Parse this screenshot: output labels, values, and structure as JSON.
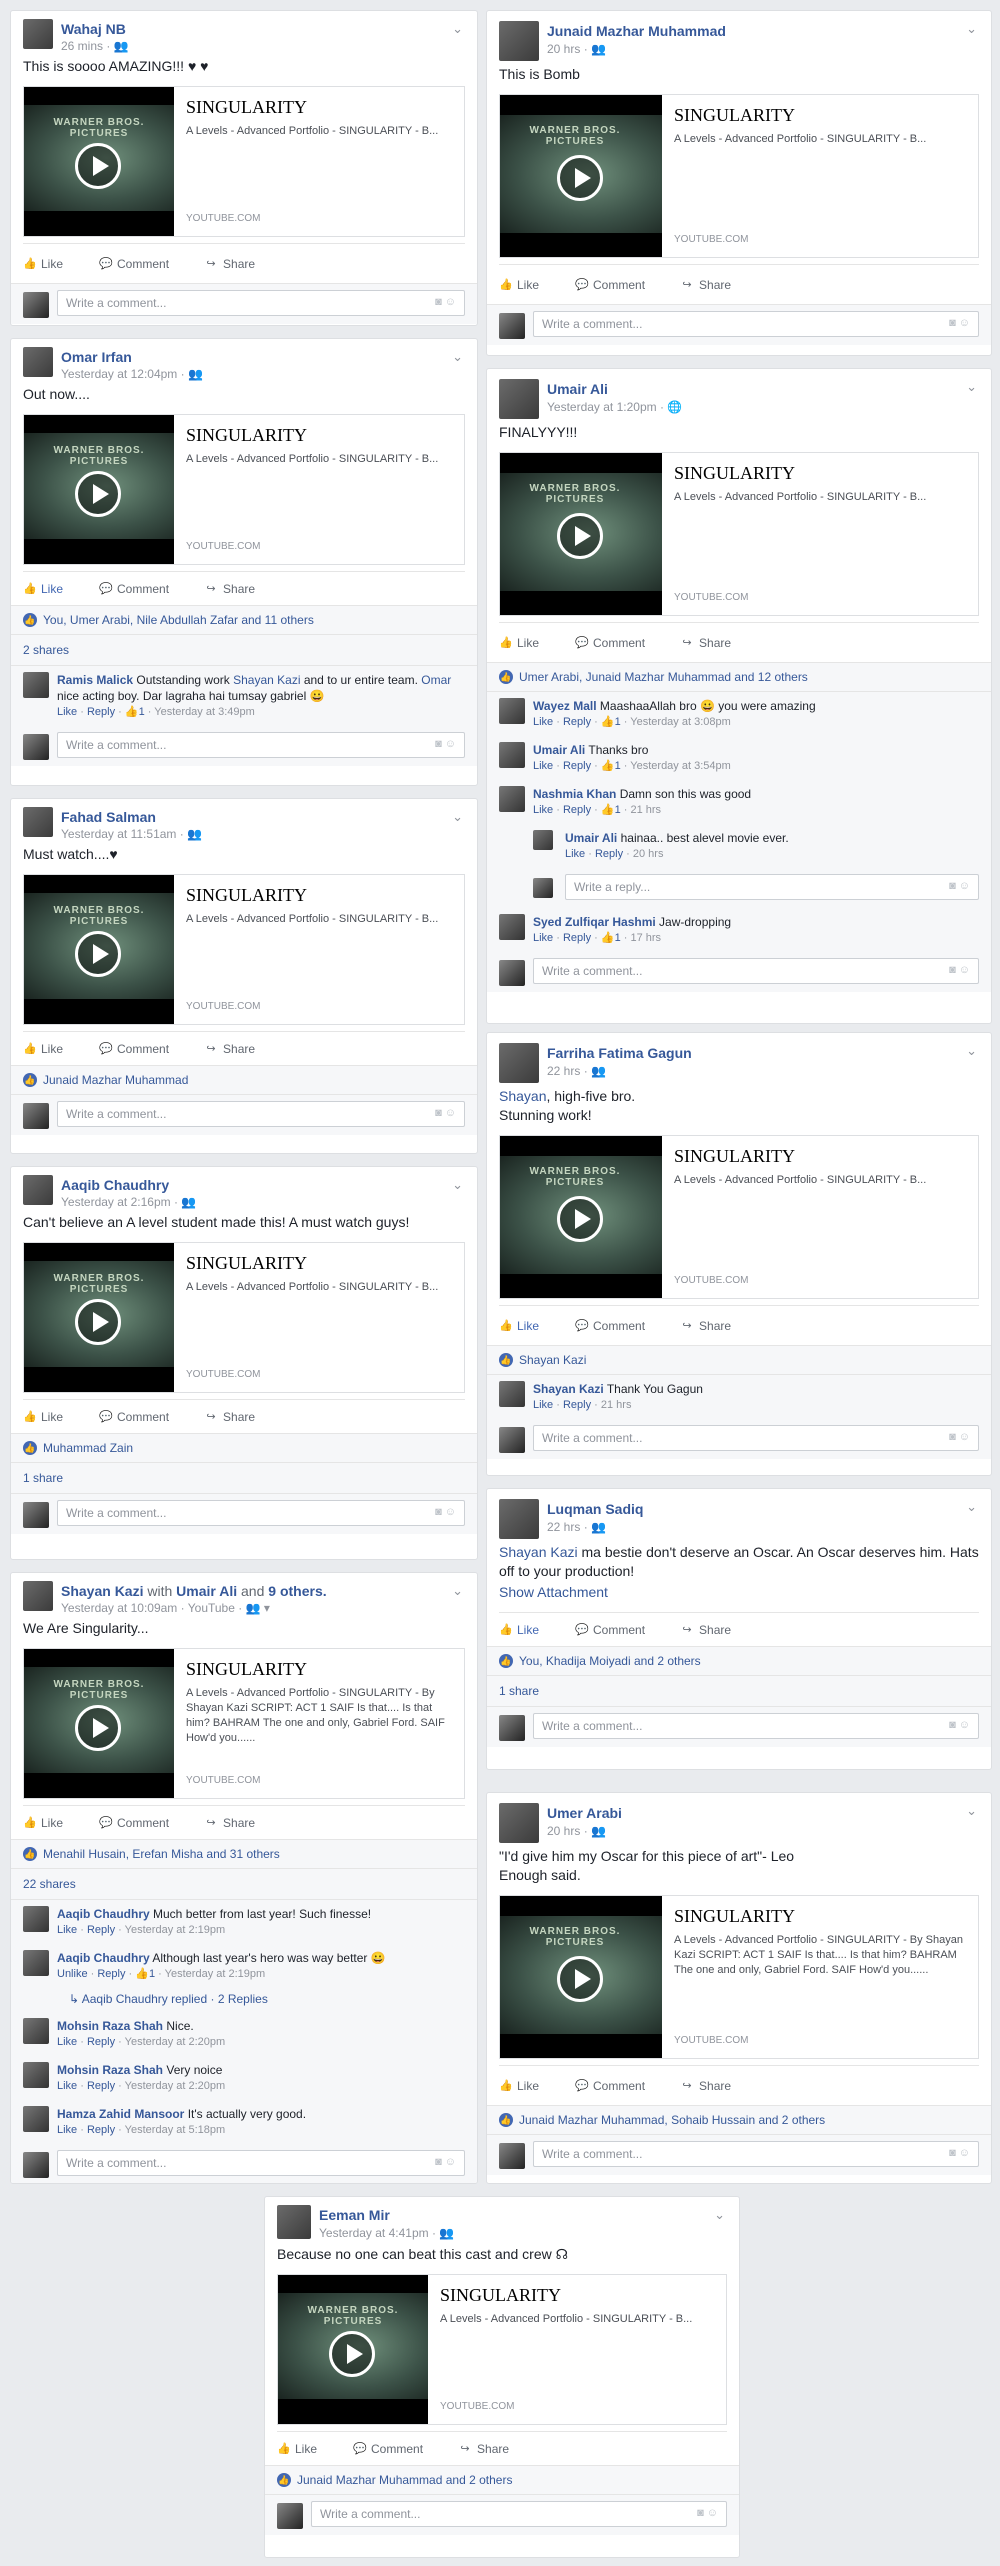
{
  "common": {
    "like": "Like",
    "comment": "Comment",
    "share": "Share",
    "reply": "Reply",
    "unlike": "Unlike",
    "write_comment": "Write a comment...",
    "write_reply": "Write a reply...",
    "camera_icon": "camera-icon",
    "emoji_icon": "smile-icon"
  },
  "link": {
    "title": "SINGULARITY",
    "desc_short": "A Levels - Advanced Portfolio - SINGULARITY - B...",
    "desc_long": "A Levels - Advanced Portfolio - SINGULARITY - By Shayan Kazi SCRIPT: ACT 1 SAIF Is that.... Is that him? BAHRAM The one and only, Gabriel Ford. SAIF How'd you......",
    "domain": "YOUTUBE.COM",
    "logo": "WARNER BROS. PICTURES"
  },
  "posts": {
    "p1": {
      "author": "Wahaj NB",
      "time": "26 mins",
      "text": "This is soooo AMAZING!!! ♥ ♥"
    },
    "p2": {
      "author": "Omar Irfan",
      "time": "Yesterday at 12:04pm",
      "text": "Out now....",
      "reactions": "You, Umer Arabi, Nile Abdullah Zafar and 11 others",
      "shares": "2 shares",
      "comment": {
        "name": "Ramis Malick",
        "pre": "Outstanding work ",
        "tag1": "Shayan Kazi",
        "mid": " and to ur entire team. ",
        "tag2": "Omar",
        "post": " nice acting boy. Dar lagraha hai tumsay gabriel 😀",
        "likes": "1",
        "time": "Yesterday at 3:49pm"
      }
    },
    "p3": {
      "author": "Fahad Salman",
      "time": "Yesterday at 11:51am",
      "text": "Must watch....♥",
      "reactions": "Junaid Mazhar Muhammad"
    },
    "p4": {
      "author": "Aaqib Chaudhry",
      "time": "Yesterday at 2:16pm",
      "text": "Can't believe an A level student made this! A must watch guys!",
      "reactions": "Muhammad Zain",
      "shares": "1 share"
    },
    "p5": {
      "author": "Shayan Kazi",
      "with": " with ",
      "tagged": "Umair Ali",
      "and": " and ",
      "others": "9 others.",
      "time": "Yesterday at 10:09am · YouTube",
      "text": "We Are Singularity...",
      "reactions": "Menahil Husain, Erefan Misha and 31 others",
      "shares": "22 shares",
      "comments": [
        {
          "name": "Aaqib Chaudhry",
          "text": "Much better from last year! Such finesse!",
          "time": "Yesterday at 2:19pm"
        },
        {
          "name": "Aaqib Chaudhry",
          "text": "Although last year's hero was way better 😀",
          "likes": "1",
          "time": "Yesterday at 2:19pm"
        },
        {
          "name": "Mohsin Raza Shah",
          "text": "Nice.",
          "time": "Yesterday at 2:20pm"
        },
        {
          "name": "Mohsin Raza Shah",
          "text": "Very noice",
          "time": "Yesterday at 2:20pm"
        },
        {
          "name": "Hamza Zahid Mansoor",
          "text": "It's actually very good.",
          "time": "Yesterday at 5:18pm"
        }
      ],
      "replied": "Aaqib Chaudhry replied · 2 Replies"
    },
    "p6": {
      "author": "Junaid Mazhar Muhammad",
      "time": "20 hrs",
      "text": "This is Bomb"
    },
    "p7": {
      "author": "Umair Ali",
      "time": "Yesterday at 1:20pm",
      "text": "FINALYYY!!!",
      "reactions": "Umer Arabi, Junaid Mazhar Muhammad and 12 others",
      "comments": [
        {
          "name": "Wayez Mall",
          "text": "MaashaaAllah bro 😀 you were amazing",
          "likes": "1",
          "time": "Yesterday at 3:08pm"
        },
        {
          "name": "Umair Ali",
          "text": "Thanks bro",
          "likes": "1",
          "time": "Yesterday at 3:54pm"
        },
        {
          "name": "Nashmia Khan",
          "text": "Damn son this was good",
          "likes": "1",
          "time": "21 hrs"
        },
        {
          "name": "Umair Ali",
          "text": "hainaa.. best alevel movie ever.",
          "time": "20 hrs"
        },
        {
          "name": "Syed Zulfiqar Hashmi",
          "text": "Jaw-dropping",
          "likes": "1",
          "time": "17 hrs"
        }
      ]
    },
    "p8": {
      "author": "Farriha Fatima Gagun",
      "time": "22 hrs",
      "tag": "Shayan",
      "text1": ", high-five bro.",
      "text2": "Stunning work!",
      "reactions": "Shayan Kazi",
      "comment": {
        "name": "Shayan Kazi",
        "text": "Thank You Gagun",
        "time": "21 hrs"
      }
    },
    "p9": {
      "author": "Luqman Sadiq",
      "time": "22 hrs",
      "tag": "Shayan Kazi",
      "text": " ma bestie don't deserve an Oscar. An Oscar deserves him. Hats off to your production!",
      "attach": "Show Attachment",
      "reactions": "You, Khadija Moiyadi and 2 others",
      "shares": "1 share"
    },
    "p10": {
      "author": "Umer Arabi",
      "time": "20 hrs",
      "text1": "\"I'd give him my Oscar for this piece of art\"- Leo",
      "text2": "Enough said.",
      "reactions": "Junaid Mazhar Muhammad, Sohaib Hussain and 2 others"
    },
    "p11": {
      "author": "Eeman Mir",
      "time": "Yesterday at 4:41pm",
      "text": "Because no one can beat this cast and crew ☊",
      "reactions": "Junaid Mazhar Muhammad and 2 others"
    }
  }
}
